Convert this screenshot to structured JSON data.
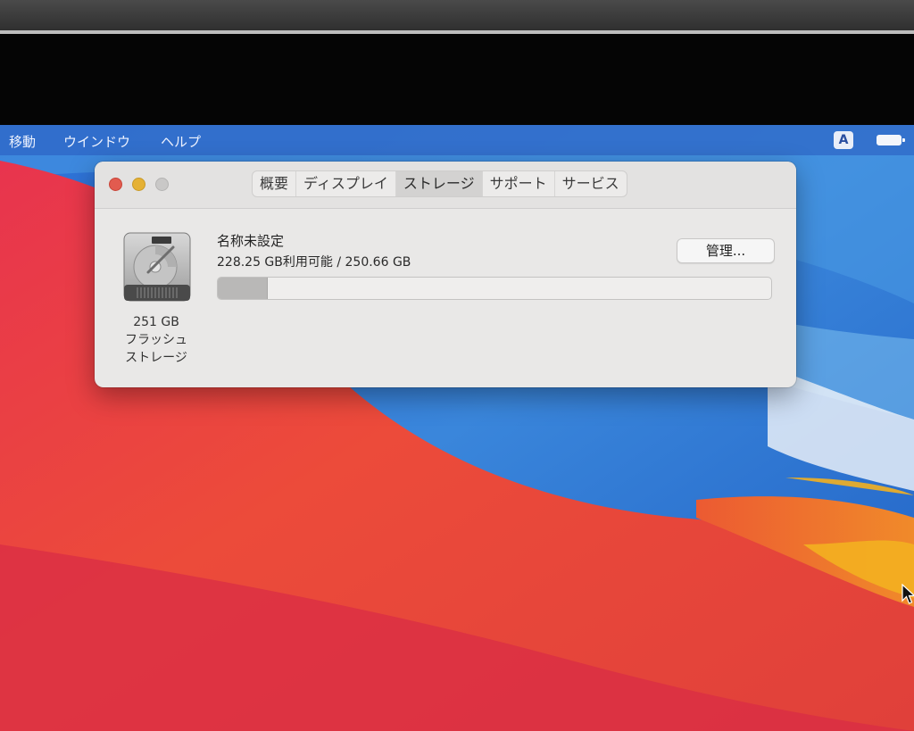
{
  "menubar": {
    "items": [
      "移動",
      "ウインドウ",
      "ヘルプ"
    ],
    "input_source": "A"
  },
  "window": {
    "tabs": [
      {
        "label": "概要",
        "selected": false
      },
      {
        "label": "ディスプレイ",
        "selected": false
      },
      {
        "label": "ストレージ",
        "selected": true
      },
      {
        "label": "サポート",
        "selected": false
      },
      {
        "label": "サービス",
        "selected": false
      }
    ],
    "disk": {
      "capacity": "251 GB",
      "type_line1": "フラッシュ",
      "type_line2": "ストレージ"
    },
    "volume": {
      "name": "名称未設定",
      "usage": "228.25 GB利用可能 / 250.66 GB",
      "used_fraction": 0.0894
    },
    "manage_label": "管理..."
  },
  "colors": {
    "window_bg": "#e9e8e7",
    "close": "#e25b4f",
    "minimize": "#e5b134",
    "zoom_disabled": "#c9c8c7",
    "usage_fill": "#b9b8b7"
  },
  "icons": {
    "disk": "internal-drive-icon",
    "battery": "battery-icon",
    "cursor": "pointer-cursor-icon"
  }
}
